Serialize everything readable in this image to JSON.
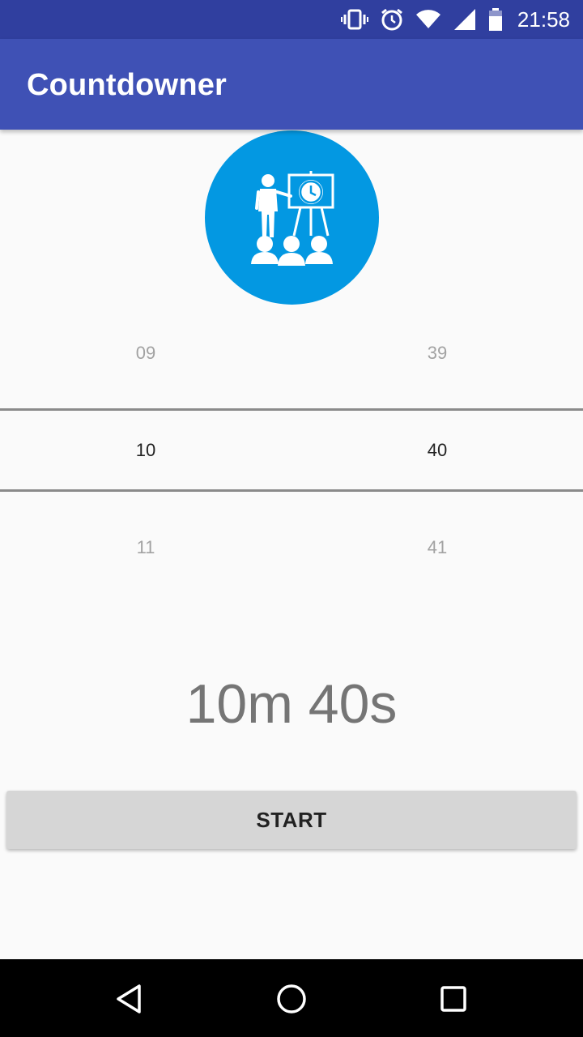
{
  "status_bar": {
    "time": "21:58",
    "icons": [
      "vibrate-icon",
      "alarm-icon",
      "wifi-icon",
      "signal-icon",
      "battery-icon"
    ]
  },
  "app_bar": {
    "title": "Countdowner"
  },
  "logo": {
    "icon": "presentation-timer-icon",
    "background_color": "#0398e2"
  },
  "picker": {
    "minutes": {
      "prev": "09",
      "selected": "10",
      "next": "11"
    },
    "seconds": {
      "prev": "39",
      "selected": "40",
      "next": "41"
    }
  },
  "time_display": "10m 40s",
  "start_button": {
    "label": "START"
  },
  "nav_bar": {
    "icons": [
      "back-icon",
      "home-icon",
      "recents-icon"
    ]
  },
  "colors": {
    "primary": "#3f51b5",
    "primary_dark": "#303f9f",
    "logo": "#0398e2"
  }
}
